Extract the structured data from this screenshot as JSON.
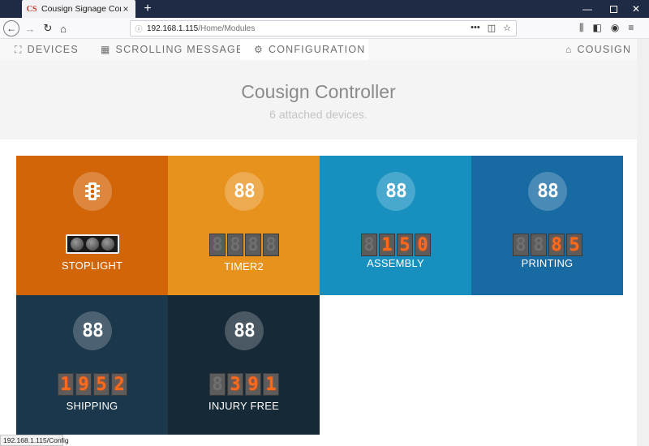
{
  "browser": {
    "tab_title": "Cousign Signage Controller",
    "tab_favicon": "CS",
    "url_host": "192.168.1.115",
    "url_path": "/Home/Modules",
    "status_url": "192.168.1.115/Config"
  },
  "nav": {
    "devices": "DEVICES",
    "scrolling_message": "SCROLLING MESSAGE",
    "configuration": "CONFIGURATION",
    "brand": "COUSIGN"
  },
  "header": {
    "title": "Cousign Controller",
    "subtitle": "6 attached devices."
  },
  "devices": [
    {
      "name": "STOPLIGHT",
      "icon": "traffic-light-icon",
      "color": "#d26508",
      "display": "stoplight"
    },
    {
      "name": "TIMER2",
      "icon": "eights",
      "color": "#e8921e",
      "digits": [
        "",
        "",
        "",
        ""
      ]
    },
    {
      "name": "ASSEMBLY",
      "icon": "eights",
      "color": "#1790c0",
      "digits": [
        "",
        "1",
        "5",
        "0"
      ]
    },
    {
      "name": "PRINTING",
      "icon": "eights",
      "color": "#176aa2",
      "digits": [
        "",
        "",
        "8",
        "5"
      ]
    },
    {
      "name": "SHIPPING",
      "icon": "eights",
      "color": "#1a374b",
      "digits": [
        "1",
        "9",
        "5",
        "2"
      ]
    },
    {
      "name": "INJURY FREE",
      "icon": "eights",
      "color": "#162936",
      "digits": [
        "",
        "3",
        "9",
        "1"
      ]
    }
  ],
  "icon_glyph": "88"
}
